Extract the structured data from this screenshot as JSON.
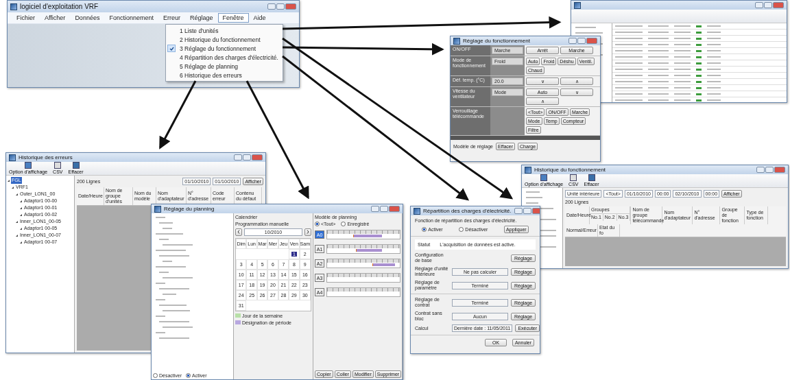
{
  "main_window": {
    "title": "logiciel d'exploitation VRF",
    "menu": [
      {
        "label": "Fichier",
        "selected": false
      },
      {
        "label": "Afficher",
        "selected": false
      },
      {
        "label": "Données",
        "selected": false
      },
      {
        "label": "Fonctionnement",
        "selected": false
      },
      {
        "label": "Erreur",
        "selected": false
      },
      {
        "label": "Réglage",
        "selected": false
      },
      {
        "label": "Fenêtre",
        "selected": true
      },
      {
        "label": "Aide",
        "selected": false
      }
    ],
    "dropdown": [
      {
        "label": "1 Liste d'unités",
        "checked": false
      },
      {
        "label": "2 Historique du fonctionnement",
        "checked": false
      },
      {
        "label": "3 Réglage du fonctionnement",
        "checked": true
      },
      {
        "label": "4 Répartition des charges d'électricité.",
        "checked": false
      },
      {
        "label": "5 Réglage de planning",
        "checked": false
      },
      {
        "label": "6 Historique des erreurs",
        "checked": false
      }
    ]
  },
  "operation_window": {
    "title": "Réglage du fonctionnement",
    "rows": [
      {
        "label": "ON/OFF",
        "value": "Marche",
        "buttons": [
          "Arrêt",
          "Marche"
        ]
      },
      {
        "label": "Mode de fonctionnement",
        "value": "Froid",
        "buttons": [
          "Auto",
          "Froid",
          "Déshu",
          "Ventil.",
          "Chaud"
        ]
      },
      {
        "label": "Déf. temp. (°C)",
        "value": "20.0",
        "buttons": [
          "∨",
          "∧"
        ]
      },
      {
        "label": "Vitesse du ventilateur",
        "value": "Mode",
        "buttons": [
          "Auto",
          "∨",
          "∧"
        ]
      },
      {
        "label": "Verrouillage télécommande",
        "buttons": [
          "<Tout>",
          "ON/OFF",
          "Marche",
          "Mode",
          "Temp",
          "Compteur",
          "Filtre"
        ]
      }
    ],
    "footer_label": "Modèle de réglage",
    "footer_buttons": [
      "Effacer",
      "Charge"
    ]
  },
  "history_window": {
    "title": "Historique du fonctionnement",
    "toolbar": [
      "Option d'affichage",
      "CSV",
      "Effacer"
    ],
    "filters": [
      "Unité intérieure",
      "<Tout>",
      "01/10/2010",
      "00:00",
      "02/10/2010",
      "00:00"
    ],
    "show_button": "Afficher",
    "count": "200 Lignes",
    "columns": [
      "Date/Heure",
      "Nom de groupe télécommande",
      "Nom d'adaptateur",
      "N° d'adresse",
      "Groupe de fonction",
      "Type de fonction",
      "Normal/Erreur",
      "Etat du fo"
    ],
    "group_heading": "Groupes",
    "group_columns": [
      "No.1",
      "No.2",
      "No.3"
    ]
  },
  "error_window": {
    "title": "Historique des erreurs",
    "toolbar": [
      "Option d'affichage",
      "CSV",
      "Effacer"
    ],
    "count": "200 Lignes",
    "dates": [
      "01/10/2010",
      "01/10/2010"
    ],
    "show_button": "Afficher",
    "date_column": "Date/Heure",
    "columns": [
      "Nom de groupe d'unités",
      "Nom du modèle",
      "Nom d'adaptateur",
      "N° d'adresse",
      "Code erreur",
      "Contenu du défaut"
    ],
    "tree": [
      {
        "label": "FGL",
        "selected": true,
        "children": [
          {
            "label": "VRF1",
            "selected": false,
            "children": [
              {
                "label": "Outer_LON1_00",
                "selected": false,
                "children": [
                  {
                    "label": "Adaptor1 00-00",
                    "selected": false
                  },
                  {
                    "label": "Adaptor1 00-01",
                    "selected": false
                  },
                  {
                    "label": "Adaptor1 00-02",
                    "selected": false
                  }
                ]
              },
              {
                "label": "Inner_LON1_00-05",
                "selected": false,
                "children": [
                  {
                    "label": "Adaptor1 00-05",
                    "selected": false
                  }
                ]
              },
              {
                "label": "Inner_LON1_00-07",
                "selected": false,
                "children": [
                  {
                    "label": "Adaptor1 00-07",
                    "selected": false
                  }
                ]
              }
            ]
          }
        ]
      }
    ]
  },
  "planning_window": {
    "title": "Réglage du planning",
    "calendar_title": "Calendrier",
    "manual_label": "Programmation manuelle",
    "month": "10/2010",
    "weekdays": [
      "Dim",
      "Lun",
      "Mar",
      "Mer",
      "Jeu",
      "Ven",
      "Sam"
    ],
    "days": [
      {
        "day": "1",
        "selected": true
      },
      {
        "day": "2",
        "selected": false
      },
      {
        "day": "3",
        "selected": false
      },
      {
        "day": "4",
        "selected": false
      },
      {
        "day": "5",
        "selected": false
      },
      {
        "day": "6",
        "selected": false
      },
      {
        "day": "7",
        "selected": false
      },
      {
        "day": "8",
        "selected": false
      },
      {
        "day": "9",
        "selected": false
      },
      {
        "day": "10",
        "selected": false
      },
      {
        "day": "11",
        "selected": false
      },
      {
        "day": "12",
        "selected": false
      },
      {
        "day": "13",
        "selected": false
      },
      {
        "day": "14",
        "selected": false
      },
      {
        "day": "15",
        "selected": false
      },
      {
        "day": "16",
        "selected": false
      },
      {
        "day": "17",
        "selected": false
      },
      {
        "day": "18",
        "selected": false
      },
      {
        "day": "19",
        "selected": false
      },
      {
        "day": "20",
        "selected": false
      },
      {
        "day": "21",
        "selected": false
      },
      {
        "day": "22",
        "selected": false
      },
      {
        "day": "23",
        "selected": false
      },
      {
        "day": "24",
        "selected": false
      },
      {
        "day": "25",
        "selected": false
      },
      {
        "day": "26",
        "selected": false
      },
      {
        "day": "27",
        "selected": false
      },
      {
        "day": "28",
        "selected": false
      },
      {
        "day": "29",
        "selected": false
      },
      {
        "day": "30",
        "selected": false
      },
      {
        "day": "31",
        "selected": false
      }
    ],
    "legend": [
      {
        "label": "Jour de la semaine",
        "color": "#b8e0a8"
      },
      {
        "label": "Désignation de période",
        "color": "#b8a8e0"
      }
    ],
    "model_title": "Modèle de planning",
    "filter_options": [
      {
        "label": "<Tout>",
        "selected": true
      },
      {
        "label": "Enregistré",
        "selected": false
      }
    ],
    "schedules": [
      {
        "label": "A0",
        "selected": true
      },
      {
        "label": "A1",
        "selected": false
      },
      {
        "label": "A2",
        "selected": false
      },
      {
        "label": "A3",
        "selected": false
      },
      {
        "label": "A4",
        "selected": false
      }
    ],
    "bottom_buttons": [
      "Copier",
      "Coller",
      "Modifier",
      "Supprimer"
    ],
    "mode_options": [
      {
        "label": "Désactiver",
        "selected": false
      },
      {
        "label": "Activer",
        "selected": true
      }
    ]
  },
  "distribution_window": {
    "title": "Répartition des charges d'électricité.",
    "heading": "Fonction de répartition des charges d'électricité.",
    "options": [
      {
        "label": "Activer",
        "selected": true
      },
      {
        "label": "Désactiver",
        "selected": false
      }
    ],
    "apply_button": "Appliquer",
    "status_label": "Statut",
    "status_text": "L'acquisition de données est active.",
    "rows": [
      {
        "label": "Configuration de base",
        "button": "Réglage"
      },
      {
        "label": "Réglage d'unité intérieure",
        "value": "Ne pas calculer",
        "button": "Réglage"
      },
      {
        "label": "Réglage de paramètre",
        "value": "Terminé",
        "button": "Réglage"
      },
      {
        "label": "Réglage de contrat",
        "value": "Terminé",
        "button": "Réglage"
      },
      {
        "label": "Contrat sans bloc",
        "value": "Aucun",
        "button": "Réglage"
      },
      {
        "label": "Calcul",
        "value": "Dernière date : 11/05/2011",
        "button": "Exécuter"
      }
    ],
    "buttons": [
      "OK",
      "Annuler"
    ]
  }
}
